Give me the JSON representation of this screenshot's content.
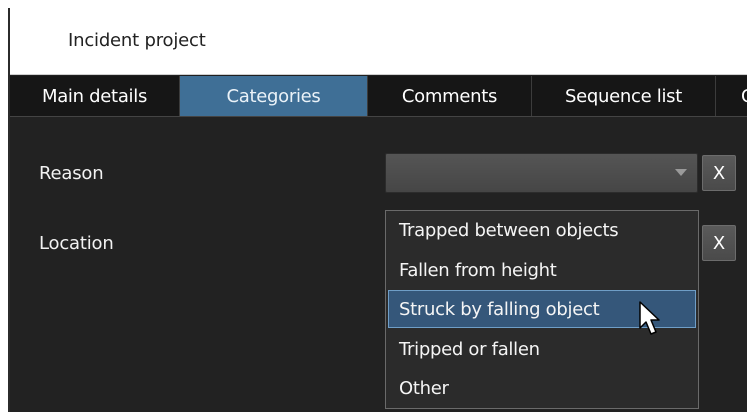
{
  "window": {
    "title": "Incident project"
  },
  "tabs": [
    {
      "label": "Main details"
    },
    {
      "label": "Categories",
      "active": true
    },
    {
      "label": "Comments"
    },
    {
      "label": "Sequence list"
    },
    {
      "label": "C"
    }
  ],
  "fields": {
    "reason": {
      "label": "Reason",
      "value": "",
      "clear_label": "X"
    },
    "location": {
      "label": "Location",
      "clear_label": "X"
    }
  },
  "dropdown": {
    "options": [
      "Trapped between objects",
      "Fallen from height",
      "Struck by falling object",
      "Tripped or fallen",
      "Other"
    ],
    "hovered_index": 2
  },
  "colors": {
    "active_tab": "#3f6f96",
    "hover_item": "#35577a",
    "background": "#222222"
  },
  "icons": {
    "dropdown_arrow": "chevron-down-icon",
    "pointer": "mouse-pointer-icon"
  }
}
